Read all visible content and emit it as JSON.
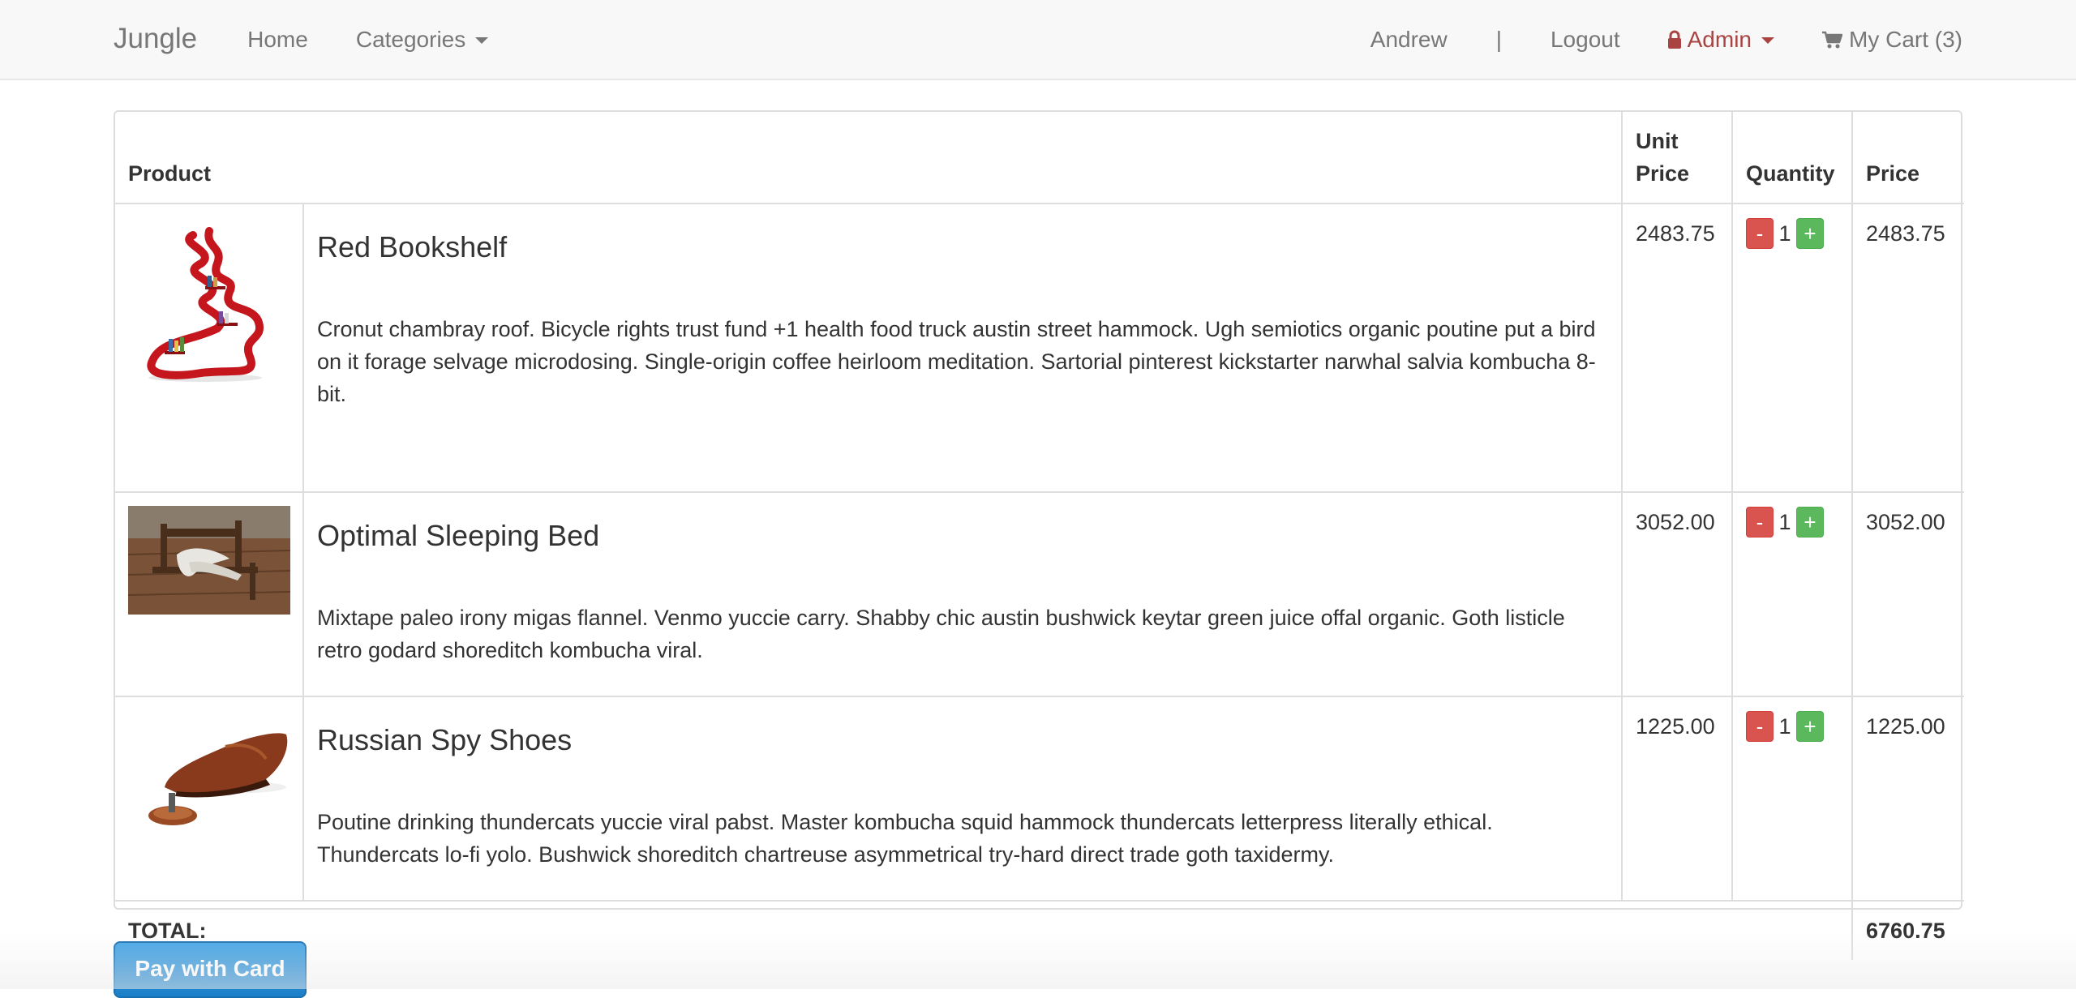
{
  "navbar": {
    "brand": "Jungle",
    "home": "Home",
    "categories": "Categories",
    "user": "Andrew",
    "separator": "|",
    "logout": "Logout",
    "admin": "Admin",
    "cart": "My Cart (3)"
  },
  "table": {
    "headers": {
      "product": "Product",
      "unit_price": "Unit Price",
      "quantity": "Quantity",
      "price": "Price"
    },
    "items": [
      {
        "name": "Red Bookshelf",
        "description": "Cronut chambray roof. Bicycle rights trust fund +1 health food truck austin street hammock. Ugh semiotics organic poutine put a bird on it forage selvage microdosing. Single-origin coffee heirloom meditation. Sartorial pinterest kickstarter narwhal salvia kombucha 8-bit.",
        "unit_price": "2483.75",
        "quantity": "1",
        "price": "2483.75"
      },
      {
        "name": "Optimal Sleeping Bed",
        "description": "Mixtape paleo irony migas flannel. Venmo yuccie carry. Shabby chic austin bushwick keytar green juice offal organic. Goth listicle retro godard shoreditch kombucha viral.",
        "unit_price": "3052.00",
        "quantity": "1",
        "price": "3052.00"
      },
      {
        "name": "Russian Spy Shoes",
        "description": "Poutine drinking thundercats yuccie viral pabst. Master kombucha squid hammock thundercats letterpress literally ethical. Thundercats lo-fi yolo. Bushwick shoreditch chartreuse asymmetrical try-hard direct trade goth taxidermy.",
        "unit_price": "1225.00",
        "quantity": "1",
        "price": "1225.00"
      }
    ],
    "qty_minus": "-",
    "qty_plus": "+",
    "total_label": "TOTAL:",
    "total_value": "6760.75"
  },
  "pay_button": "Pay with Card",
  "colors": {
    "navbar_bg": "#f8f8f8",
    "admin_red": "#a94442",
    "minus_red": "#d9534f",
    "plus_green": "#5cb85c",
    "pay_blue": "#2a8fd8"
  },
  "icons": [
    "caret-down-icon",
    "lock-icon",
    "shopping-cart-icon"
  ]
}
